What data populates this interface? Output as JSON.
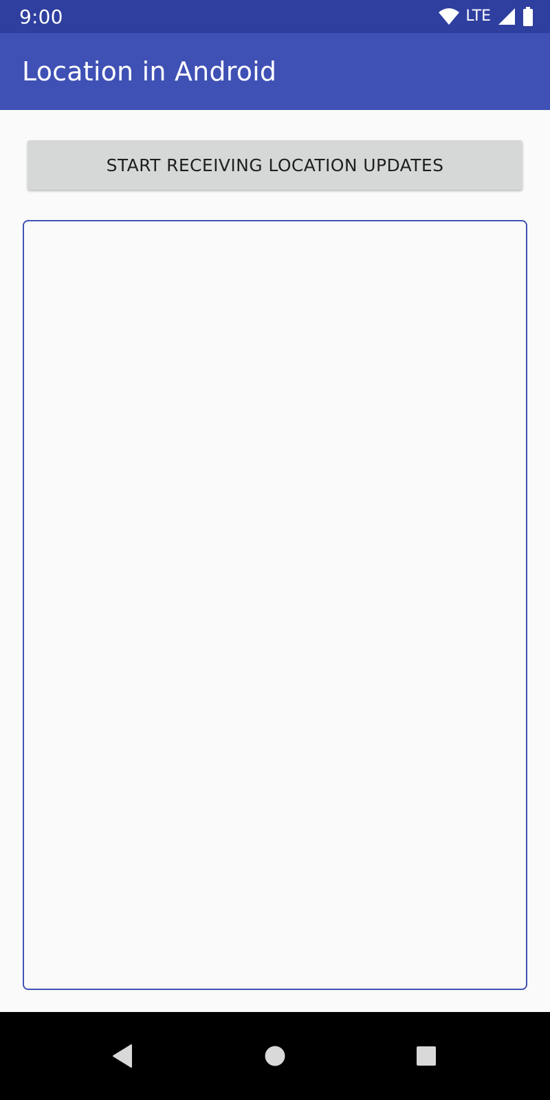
{
  "status_bar": {
    "time": "9:00",
    "network_label": "LTE",
    "icons": [
      "wifi-icon",
      "signal-icon",
      "battery-icon"
    ]
  },
  "app_bar": {
    "title": "Location in Android"
  },
  "main": {
    "start_button_label": "START RECEIVING LOCATION UPDATES",
    "output_text": ""
  },
  "nav_bar": {
    "icons": [
      "back-icon",
      "home-icon",
      "recents-icon"
    ]
  },
  "colors": {
    "status_bar": "#2f3f9f",
    "app_bar": "#3f51b5",
    "button": "#d6d7d7",
    "output_border": "#3f51b5",
    "background": "#fafafa",
    "nav_bar": "#000000",
    "nav_icons": "#d9d9d9"
  }
}
